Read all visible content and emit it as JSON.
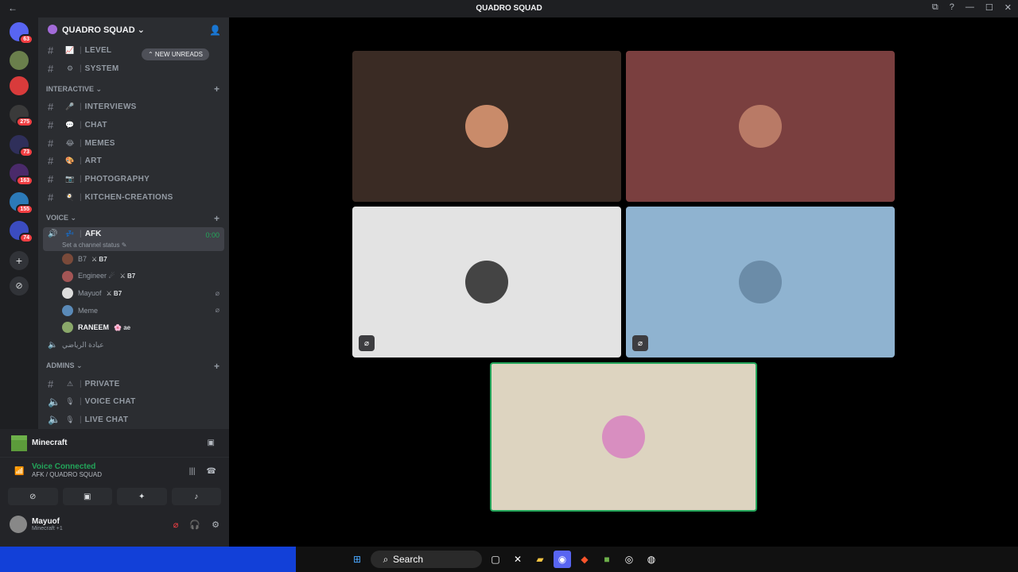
{
  "window": {
    "title": "QUADRO SQUAD",
    "back": "←",
    "controls": [
      "⧉",
      "?",
      "—",
      "☐",
      "✕"
    ]
  },
  "guilds": [
    {
      "color": "#5865f2",
      "badge": "63"
    },
    {
      "color": "#6a7f4c",
      "badge": ""
    },
    {
      "color": "#d93b3b",
      "badge": ""
    },
    {
      "color": "#3a3a3a",
      "badge": "275"
    },
    {
      "color": "#2f2f5a",
      "badge": "73"
    },
    {
      "color": "#4a2a6a",
      "badge": "163"
    },
    {
      "color": "#2c7ab8",
      "badge": "155"
    },
    {
      "color": "#3b4cc0",
      "badge": "74"
    }
  ],
  "server": {
    "name": "QUADRO SQUAD ⌄"
  },
  "new_unreads": "⌃ NEW UNREADS",
  "top_channels": [
    {
      "emoji": "📈",
      "name": "LEVEL"
    },
    {
      "emoji": "⚙",
      "name": "SYSTEM"
    }
  ],
  "categories": {
    "interactive": "INTERACTIVE ⌄",
    "voice": "VOICE ⌄",
    "admins": "ADMINS ⌄"
  },
  "interactive_channels": [
    {
      "emoji": "🎤",
      "name": "INTERVIEWS"
    },
    {
      "emoji": "💬",
      "name": "CHAT"
    },
    {
      "emoji": "😂",
      "name": "MEMES"
    },
    {
      "emoji": "🎨",
      "name": "ART"
    },
    {
      "emoji": "📷",
      "name": "PHOTOGRAPHY"
    },
    {
      "emoji": "🍳",
      "name": "KITCHEN-CREATIONS"
    }
  ],
  "afk": {
    "name": "AFK",
    "time": "0:00",
    "status": "Set a channel status ✎"
  },
  "voice_users": [
    {
      "name": "B7",
      "tag": "⚔ B7",
      "color": "#7a4a3a",
      "muted": false
    },
    {
      "name": "Engineer ☄",
      "tag": "⚔ B7",
      "color": "#a35555",
      "muted": false
    },
    {
      "name": "Mayuof",
      "tag": "⚔ B7",
      "color": "#ddd",
      "muted": true
    },
    {
      "name": "Meme",
      "tag": "",
      "color": "#5a8ab8",
      "muted": true
    },
    {
      "name": "RANEEM",
      "tag": "🌸 ae",
      "color": "#8aa86a",
      "muted": false
    }
  ],
  "arabic_channel": "عيادة الرياضي",
  "admin_channels": [
    {
      "emoji": "⚠",
      "name": "PRIVATE"
    },
    {
      "emoji": "🎙",
      "name": "VOICE CHAT"
    },
    {
      "emoji": "🎙",
      "name": "LIVE CHAT"
    }
  ],
  "activity": {
    "name": "Minecraft"
  },
  "voice_connected": {
    "label": "Voice Connected",
    "channel": "AFK / QUADRO SQUAD"
  },
  "user": {
    "name": "Mayuof",
    "sub": "Minecraft +1"
  },
  "tiles": [
    {
      "bg": "#3a2b24",
      "avatar": "#c98b6a",
      "muted": false
    },
    {
      "bg": "#7a3f3f",
      "avatar": "#b97a66",
      "muted": false
    },
    {
      "bg": "#e3e3e3",
      "avatar": "#444",
      "muted": true
    },
    {
      "bg": "#8fb3d0",
      "avatar": "#6b8ca8",
      "muted": true
    },
    {
      "bg": "#ddd4c0",
      "avatar": "#d88ec0",
      "muted": false
    }
  ],
  "taskbar": {
    "search": "Search"
  }
}
